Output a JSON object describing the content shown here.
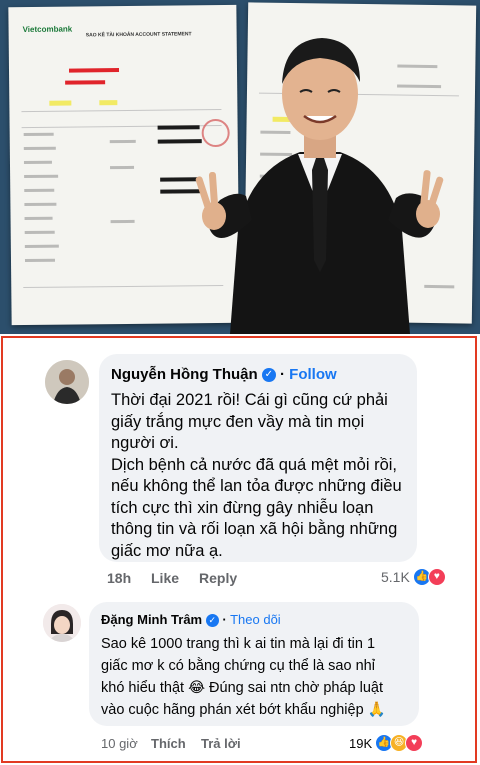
{
  "photo": {
    "bank_brand": "Vietcombank",
    "statement_title": "SAO KÊ TÀI KHOẢN ACCOUNT STATEMENT"
  },
  "comments": [
    {
      "author": "Nguyễn Hồng Thuận",
      "follow_label": "Follow",
      "lines": [
        "Thời đại 2021 rồi! Cái gì cũng cứ phải",
        "giấy trắng mực đen vầy mà tin mọi",
        "người ơi.",
        "Dịch bệnh cả nước đã quá mệt mỏi rồi,",
        "nếu không thể lan tỏa được những điều",
        "tích cực thì xin đừng gây nhiễu loạn",
        "thông tin và rối loạn xã hội bằng những",
        "giấc mơ nữa ạ."
      ],
      "time": "18h",
      "like_label": "Like",
      "reply_label": "Reply",
      "reaction_count": "5.1K",
      "reaction_icons": [
        "like-icon",
        "love-icon"
      ]
    },
    {
      "author": "Đặng Minh Trâm",
      "follow_label": "Theo dõi",
      "lines": [
        "Sao kê 1000 trang thì k ai tin mà lại đi tin 1",
        "giấc mơ k có bằng chứng cụ thể là sao nhỉ",
        "khó hiểu thật 😂 Đúng sai ntn chờ pháp luật",
        "vào cuộc hãng phán xét bớt khẩu nghiệp 🙏"
      ],
      "time": "10 giờ",
      "like_label": "Thích",
      "reply_label": "Trả lời",
      "reaction_count": "19K",
      "reaction_icons": [
        "like-icon",
        "haha-icon",
        "love-icon"
      ]
    }
  ],
  "colors": {
    "panel_border": "#e23a22",
    "bubble": "#f0f2f5",
    "link_blue": "#1877f2",
    "meta_gray": "#65676b"
  }
}
